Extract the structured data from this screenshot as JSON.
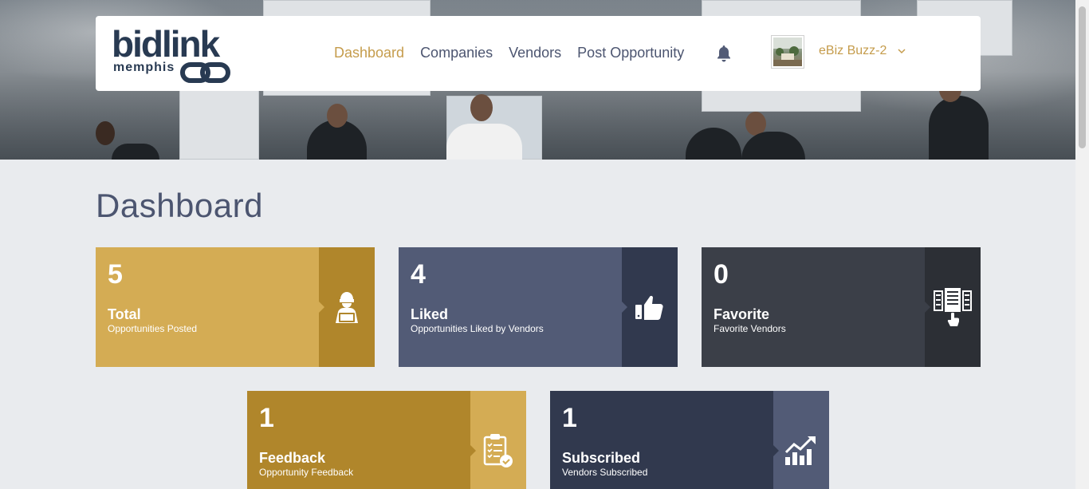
{
  "brand": {
    "word": "bidlink",
    "sub": "memphis"
  },
  "nav": {
    "items": [
      {
        "label": "Dashboard",
        "active": true
      },
      {
        "label": "Companies",
        "active": false
      },
      {
        "label": "Vendors",
        "active": false
      },
      {
        "label": "Post Opportunity",
        "active": false
      }
    ]
  },
  "user": {
    "name": "eBiz Buzz-2"
  },
  "icons": {
    "notifications": "bell-icon",
    "menu": "chevron-down-icon"
  },
  "page": {
    "title": "Dashboard"
  },
  "cards": [
    {
      "value": "5",
      "label": "Total",
      "sub": "Opportunities Posted",
      "icon": "user-laptop-icon",
      "main_color": "#d4ac54",
      "side_color": "#b0862b"
    },
    {
      "value": "4",
      "label": "Liked",
      "sub": "Opportunities Liked by Vendors",
      "icon": "thumbs-up-icon",
      "main_color": "#525b76",
      "side_color": "#31394e"
    },
    {
      "value": "0",
      "label": "Favorite",
      "sub": "Favorite Vendors",
      "icon": "vendor-select-icon",
      "main_color": "#3b3f48",
      "side_color": "#2c2f35"
    },
    {
      "value": "1",
      "label": "Feedback",
      "sub": "Opportunity Feedback",
      "icon": "clipboard-check-icon",
      "main_color": "#b0862b",
      "side_color": "#d4ac54"
    },
    {
      "value": "1",
      "label": "Subscribed",
      "sub": "Vendors Subscribed",
      "icon": "growth-chart-icon",
      "main_color": "#31394e",
      "side_color": "#525b76"
    }
  ]
}
